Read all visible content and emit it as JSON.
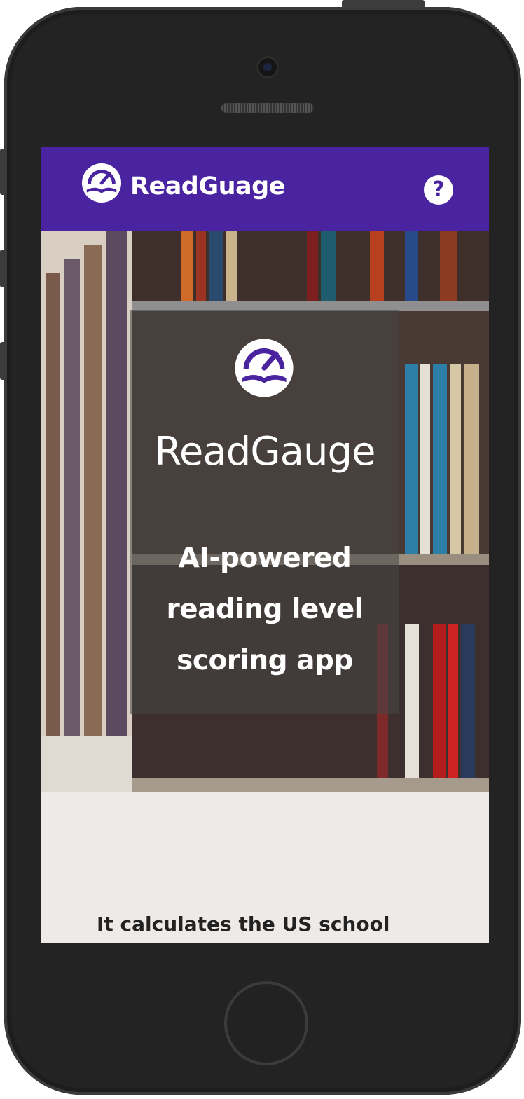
{
  "app": {
    "header_title": "ReadGuage",
    "help_label": "?",
    "accent_color": "#4a24a0"
  },
  "hero": {
    "brand": "ReadGauge",
    "tagline": "AI-powered reading level scoring app",
    "background": "library-bookshelves-photo",
    "logo_icon": "gauge-book-icon"
  },
  "content": {
    "intro_text": "It calculates the US school"
  },
  "icons": {
    "header_logo": "gauge-book-icon",
    "help": "question-mark-icon"
  }
}
